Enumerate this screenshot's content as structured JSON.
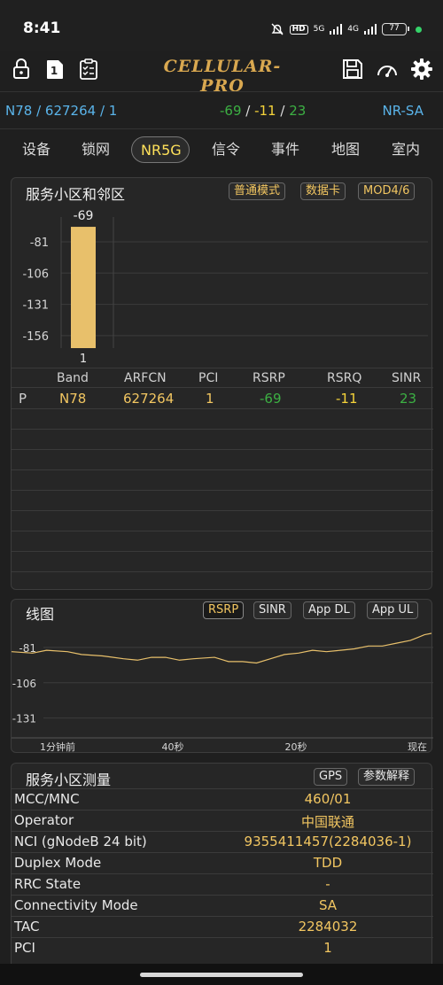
{
  "status_bar": {
    "time": "8:41",
    "hd": "HD",
    "net5g": "5G",
    "net4g": "4G",
    "battery": "77",
    "icons": [
      "bell-off-icon",
      "signal-icon",
      "battery-icon",
      "privacy-dot-icon"
    ]
  },
  "app_bar": {
    "title": "CELLULAR-PRO",
    "left_icons": [
      "lock-icon",
      "sim-card-icon",
      "clipboard-icon"
    ],
    "right_icons": [
      "save-icon",
      "speedometer-icon",
      "gear-icon"
    ],
    "sim_number": "1"
  },
  "info_row": {
    "band": "N78",
    "sep": " / ",
    "arfcn": "627264",
    "pci": "1",
    "rsrp": "-69",
    "rsrq": "-11",
    "sinr": "23",
    "mode": "NR-SA",
    "colors": {
      "rsrp": "#3cb043",
      "rsrq": "#f5d33a",
      "sinr": "#3cb043"
    }
  },
  "tabs": [
    "设备",
    "锁网",
    "NR5G",
    "信令",
    "事件",
    "地图",
    "室内"
  ],
  "active_tab": "NR5G",
  "serving_panel": {
    "title": "服务小区和邻区",
    "chips": [
      "普通模式",
      "数据卡",
      "MOD4/6"
    ],
    "chart_data": {
      "type": "bar",
      "categories": [
        "1"
      ],
      "values": [
        -69
      ],
      "value_label": "-69",
      "y_ticks": [
        "-81",
        "-106",
        "-131",
        "-156"
      ],
      "ylim": [
        -166,
        -64
      ],
      "bar_color": "#e8c06b"
    },
    "table": {
      "headers": [
        "Band",
        "ARFCN",
        "PCI",
        "RSRP",
        "RSRQ",
        "SINR"
      ],
      "rows": [
        {
          "type": "P",
          "band": "N78",
          "arfcn": "627264",
          "pci": "1",
          "rsrp": "-69",
          "rsrq": "-11",
          "sinr": "23"
        }
      ]
    }
  },
  "line_panel": {
    "title": "线图",
    "chips": [
      "RSRP",
      "SINR",
      "App DL",
      "App UL"
    ],
    "active_chip": "RSRP",
    "chart_data": {
      "type": "line",
      "y_ticks": [
        "-81",
        "-106",
        "-131"
      ],
      "x_ticks": [
        "1分钟前",
        "40秒",
        "20秒",
        "现在"
      ],
      "ylim": [
        -145,
        -66
      ],
      "xlim": [
        -60,
        0
      ],
      "series": [
        {
          "color": "#e8c06b",
          "x": [
            -60,
            -57,
            -55,
            -52,
            -50,
            -47,
            -44,
            -42,
            -40,
            -38,
            -36,
            -34,
            -31,
            -29,
            -27,
            -25,
            -23,
            -21,
            -19,
            -17,
            -15,
            -13,
            -11,
            -9,
            -7,
            -5,
            -3,
            -2,
            -1,
            0
          ],
          "y": [
            -84,
            -85,
            -83,
            -84,
            -86,
            -87,
            -89,
            -90,
            -88,
            -88,
            -90,
            -89,
            -88,
            -91,
            -91,
            -92,
            -89,
            -86,
            -85,
            -83,
            -84,
            -83,
            -82,
            -80,
            -80,
            -78,
            -76,
            -74,
            -72,
            -71
          ]
        }
      ]
    }
  },
  "measurement_panel": {
    "title": "服务小区测量",
    "chips": [
      "GPS",
      "参数解释"
    ],
    "rows": [
      {
        "label": "MCC/MNC",
        "value": "460/01"
      },
      {
        "label": "Operator",
        "value": "中国联通"
      },
      {
        "label": "NCI (gNodeB 24 bit)",
        "value": "9355411457(2284036-1)"
      },
      {
        "label": "Duplex Mode",
        "value": "TDD"
      },
      {
        "label": "RRC State",
        "value": "-"
      },
      {
        "label": "Connectivity Mode",
        "value": "SA"
      },
      {
        "label": "TAC",
        "value": "2284032"
      },
      {
        "label": "PCI",
        "value": "1"
      }
    ]
  }
}
